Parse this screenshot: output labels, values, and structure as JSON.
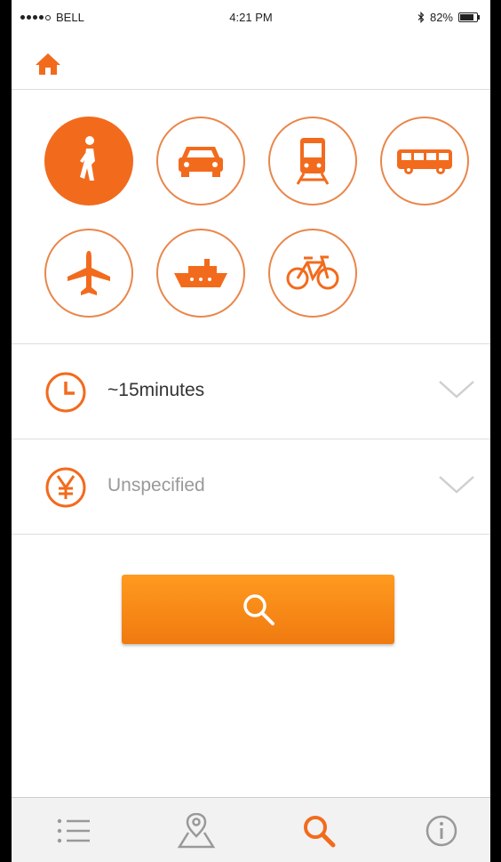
{
  "status_bar": {
    "carrier": "BELL",
    "time": "4:21 PM",
    "battery": "82%"
  },
  "transport_modes": [
    {
      "name": "walk",
      "selected": true
    },
    {
      "name": "car",
      "selected": false
    },
    {
      "name": "train",
      "selected": false
    },
    {
      "name": "bus",
      "selected": false
    },
    {
      "name": "airplane",
      "selected": false
    },
    {
      "name": "ship",
      "selected": false
    },
    {
      "name": "bicycle",
      "selected": false
    }
  ],
  "time_filter": {
    "value": "~15minutes",
    "icon": "clock-icon"
  },
  "price_filter": {
    "value": "Unspecified",
    "icon": "yen-icon"
  },
  "search_button": {
    "icon": "search-icon"
  },
  "tabbar": {
    "items": [
      "list-icon",
      "map-pin-icon",
      "search-icon",
      "info-icon"
    ],
    "active": "search-icon"
  },
  "colors": {
    "accent": "#f26b1d",
    "ring": "#e9864a",
    "button_top": "#ff9a1f",
    "button_bottom": "#f07a10"
  }
}
